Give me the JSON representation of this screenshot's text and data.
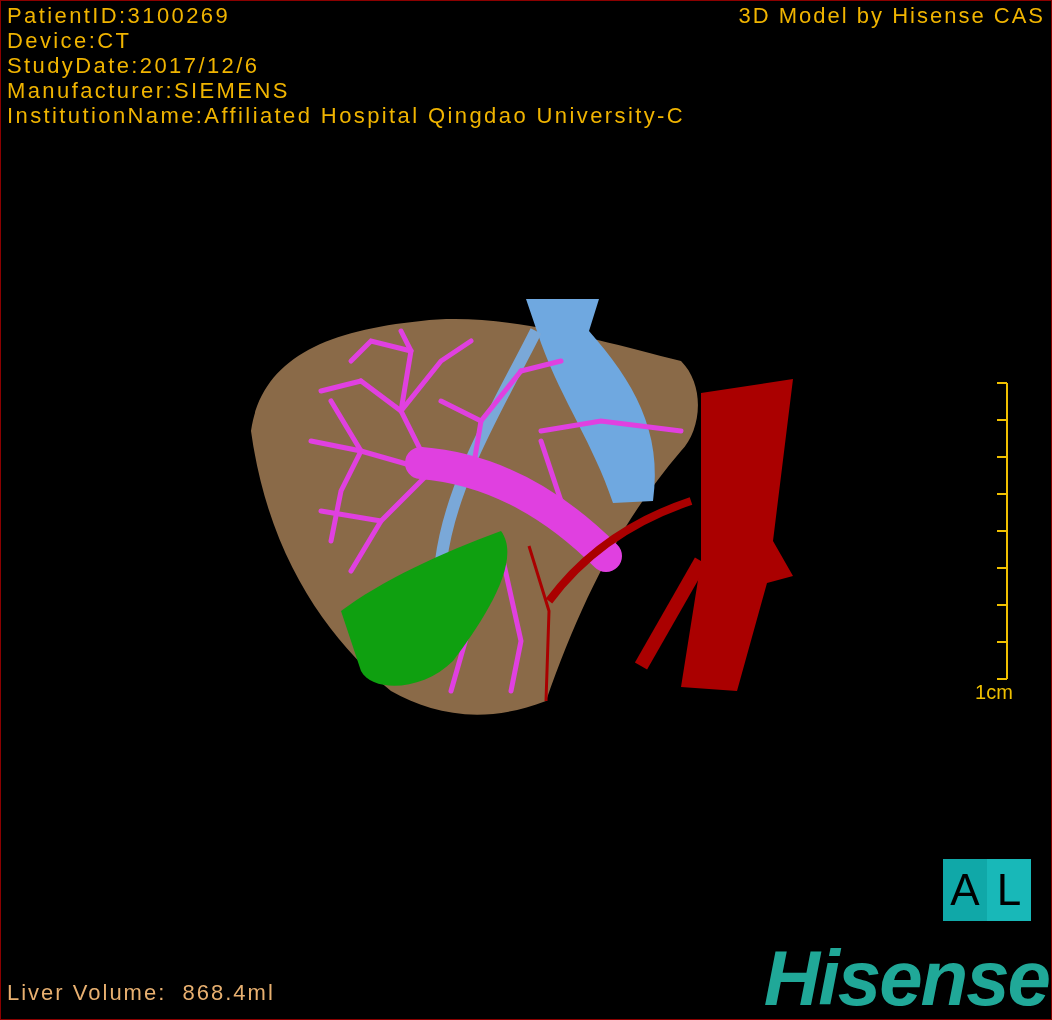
{
  "info_lines": [
    "PatientID:3100269",
    "Device:CT",
    "StudyDate:2017/12/6",
    "Manufacturer:SIEMENS",
    "InstitutionName:Affiliated Hospital Qingdao University-C"
  ],
  "credit": "3D Model by Hisense CAS",
  "scale": {
    "label": "1cm"
  },
  "orientation": [
    "A",
    "L"
  ],
  "volume": "Liver Volume:  868.4ml",
  "logo": "Hisense"
}
